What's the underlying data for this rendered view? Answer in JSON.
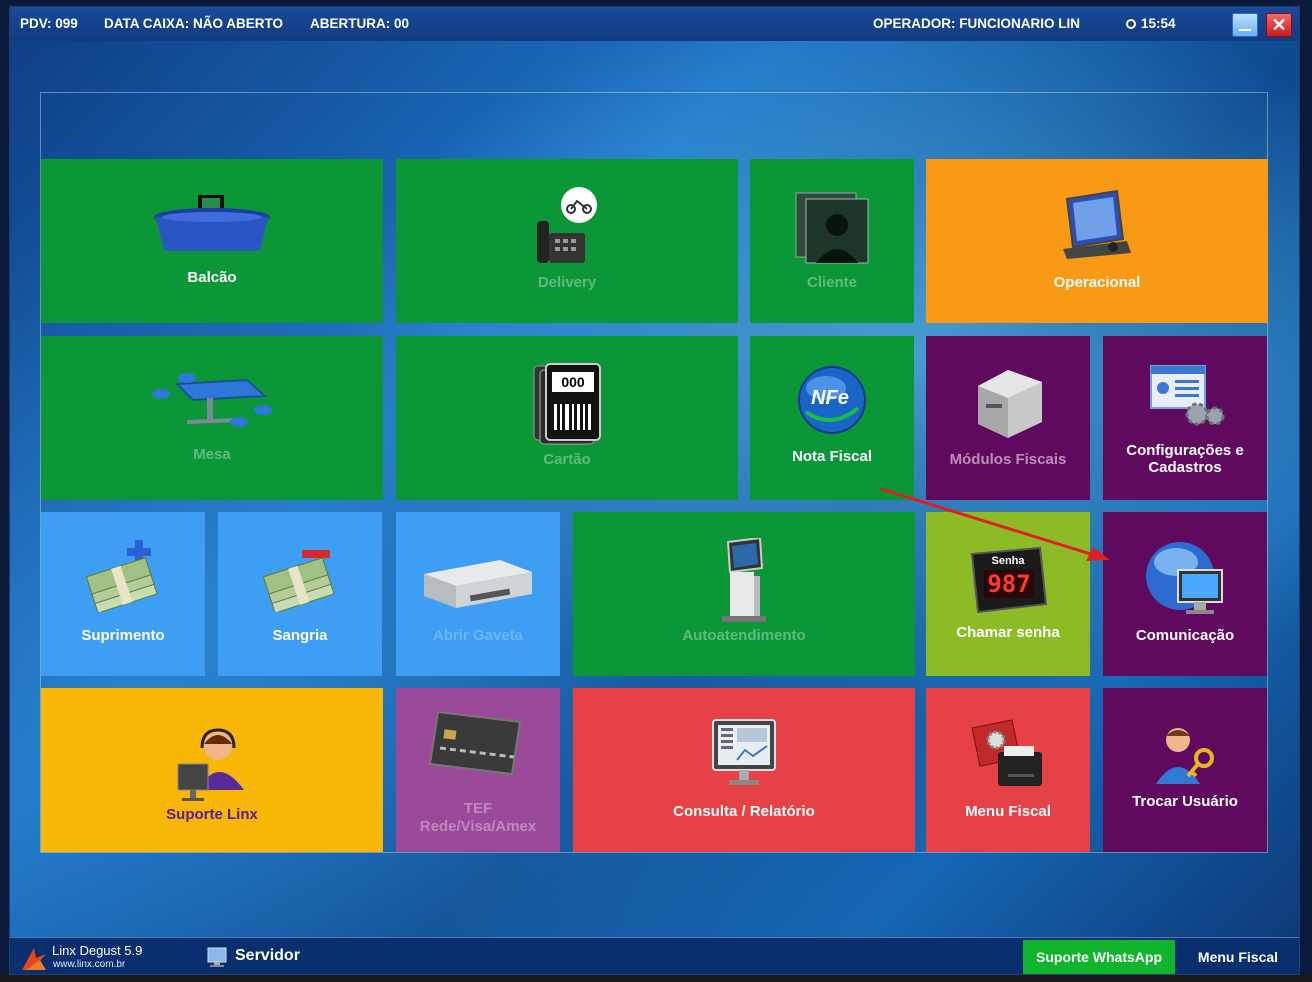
{
  "header": {
    "pdv": "PDV: 099",
    "data_caixa": "DATA CAIXA: NÃO ABERTO",
    "abertura": "ABERTURA: 00",
    "operador": "OPERADOR: FUNCIONARIO LIN",
    "time": "15:54",
    "close_glyph": "✕"
  },
  "tiles": {
    "balcao": "Balcão",
    "delivery": "Delivery",
    "cliente": "Cliente",
    "operacional": "Operacional",
    "mesa": "Mesa",
    "cartao": "Cartão",
    "nota_fiscal": "Nota Fiscal",
    "modulos_fiscais": "Módulos Fiscais",
    "configuracoes_1": "Configurações e",
    "configuracoes_2": "Cadastros",
    "suprimento": "Suprimento",
    "sangria": "Sangria",
    "abrir_gaveta": "Abrir Gaveta",
    "autoatendimento": "Autoatendimento",
    "chamar_senha": "Chamar senha",
    "comunicacao": "Comunicação",
    "suporte_linx": "Suporte Linx",
    "tef_1": "TEF",
    "tef_2": "Rede/Visa/Amex",
    "consulta": "Consulta / Relatório",
    "menu_fiscal": "Menu Fiscal",
    "trocar_usuario": "Trocar Usuário"
  },
  "icon_text": {
    "cartao_code": "000",
    "senha_label": "Senha",
    "senha_number": "987",
    "nfe": "NFe"
  },
  "footer": {
    "app_name": "Linx Degust 5.9",
    "app_url": "www.linx.com.br",
    "servidor": "Servidor",
    "whatsapp": "Suporte WhatsApp",
    "menu_fiscal": "Menu Fiscal"
  },
  "colors": {
    "green": "#0b9638",
    "orange": "#f89a16",
    "purple": "#5f0a5e",
    "blue": "#3d9ef3",
    "lime": "#8dbb26",
    "yellow": "#f8b706",
    "violet": "#9b4a9a",
    "red": "#e64147"
  }
}
